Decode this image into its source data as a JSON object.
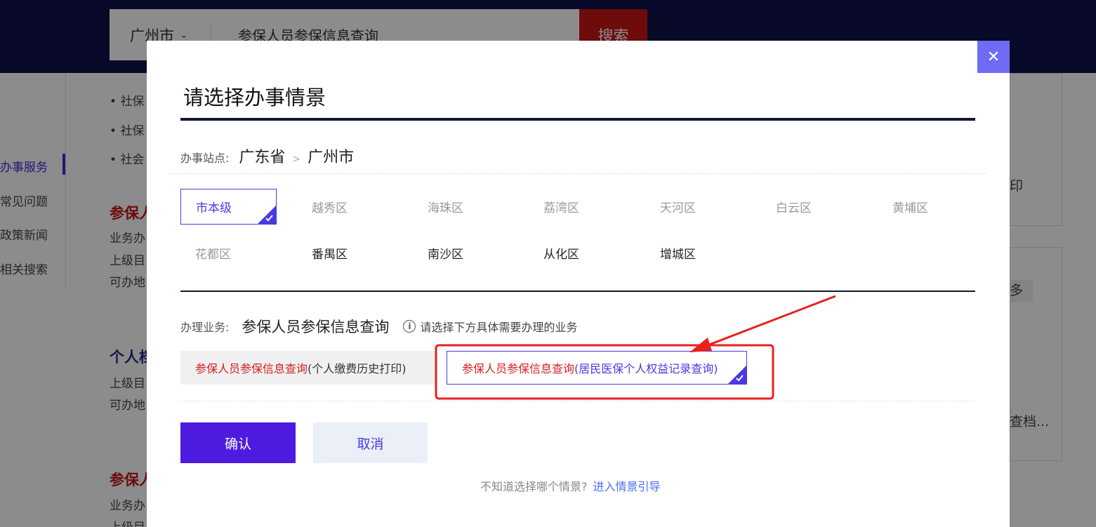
{
  "header": {
    "city": "广州市",
    "search_query": "参保人员参保信息查询",
    "search_button": "搜索"
  },
  "background": {
    "nav": [
      "办事服务",
      "常见问题",
      "政策新闻",
      "相关搜索"
    ],
    "bullets": [
      "社保",
      "社保",
      "社会"
    ],
    "red_titles": [
      "参保人",
      "参保人"
    ],
    "blue_title": "个人档",
    "lines": [
      "业务办",
      "上级目",
      "可办地",
      "上级目",
      "可办地",
      "业务办",
      "上级目"
    ],
    "right_fragments": [
      "印",
      "多",
      "档",
      "查档..."
    ]
  },
  "modal": {
    "title": "请选择办事情景",
    "close_icon": "close-icon",
    "site_label": "办事站点:",
    "site_province": "广东省",
    "site_separator": ">",
    "site_city": "广州市",
    "districts": [
      {
        "name": "市本级",
        "state": "selected"
      },
      {
        "name": "越秀区",
        "state": "disabled"
      },
      {
        "name": "海珠区",
        "state": "disabled"
      },
      {
        "name": "荔湾区",
        "state": "disabled"
      },
      {
        "name": "天河区",
        "state": "disabled"
      },
      {
        "name": "白云区",
        "state": "disabled"
      },
      {
        "name": "黄埔区",
        "state": "disabled"
      },
      {
        "name": "花都区",
        "state": "disabled"
      },
      {
        "name": "番禺区",
        "state": "enabled"
      },
      {
        "name": "南沙区",
        "state": "enabled"
      },
      {
        "name": "从化区",
        "state": "enabled"
      },
      {
        "name": "增城区",
        "state": "enabled"
      }
    ],
    "business_label": "办理业务:",
    "business_name": "参保人员参保信息查询",
    "business_hint": "请选择下方具体需要办理的业务",
    "options": [
      {
        "main": "参保人员参保信息查询",
        "sub": "(个人缴费历史打印)",
        "selected": false
      },
      {
        "main": "参保人员参保信息查询",
        "sub": "(居民医保个人权益记录查询)",
        "selected": true
      }
    ],
    "confirm_button": "确认",
    "cancel_button": "取消",
    "footer_question": "不知道选择哪个情景?",
    "footer_link": "进入情景引导"
  },
  "colors": {
    "accent": "#4a3ae0",
    "confirm_bg": "#4d1be0",
    "annotation_red": "#e82020",
    "top_bar": "#10104a"
  }
}
